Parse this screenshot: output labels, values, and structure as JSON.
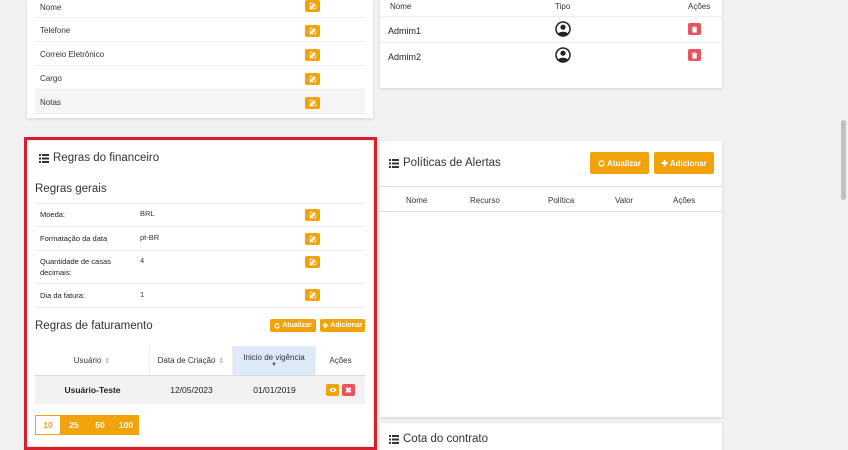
{
  "contact": {
    "rows": [
      "Nome",
      "Telefone",
      "Correio Eletrônico",
      "Cargo",
      "Notas"
    ]
  },
  "admins": {
    "headers": {
      "name": "Nome",
      "type": "Tipo",
      "actions": "Ações"
    },
    "rows": [
      {
        "name": "Admim1"
      },
      {
        "name": "Admim2"
      }
    ]
  },
  "finance": {
    "title": "Regras do financeiro",
    "general_title": "Regras gerais",
    "rules": [
      {
        "label": "Moeda:",
        "value": "BRL"
      },
      {
        "label": "Formatação da data",
        "value": "pt-BR"
      },
      {
        "label": "Quantidade de casas decimais:",
        "value": "4"
      },
      {
        "label": "Dia da fatura:",
        "value": "1"
      }
    ],
    "billing_title": "Regras de faturamento",
    "refresh_label": "Atualizar",
    "add_label": "Adicionar",
    "table": {
      "headers": [
        "Usuário",
        "Data de Criação",
        "Inicio de vigência",
        "Ações"
      ],
      "rows": [
        {
          "user": "Usuário-Teste",
          "created": "12/05/2023",
          "start": "01/01/2019"
        }
      ]
    },
    "page_sizes": [
      "10",
      "25",
      "50",
      "100"
    ],
    "active_page_size": "10"
  },
  "alerts": {
    "title": "Políticas de Alertas",
    "refresh_label": "Atualizar",
    "add_label": "Adicionar",
    "headers": [
      "Nome",
      "Recurso",
      "Política",
      "Valor",
      "Ações"
    ]
  },
  "quota": {
    "title": "Cota do contrato"
  },
  "colors": {
    "accent": "#f0a30a",
    "danger": "#e8545c",
    "highlight": "#d9202a"
  }
}
